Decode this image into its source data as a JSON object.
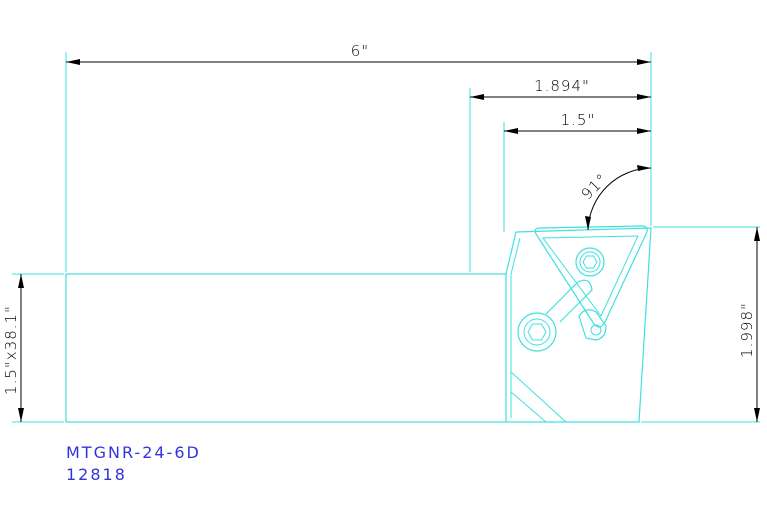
{
  "dimensions": {
    "overall_length": "6\"",
    "length_1894": "1.894\"",
    "length_15": "1.5\"",
    "angle": "91°",
    "height": "1.998\"",
    "shank": "1.5\"x38.1\""
  },
  "title_block": {
    "part_number": "MTGNR-24-6D",
    "item_number": "12818"
  },
  "colors": {
    "part_outline": "#3fe0e0",
    "dimension": "#000000",
    "title_text": "#3333dd"
  }
}
